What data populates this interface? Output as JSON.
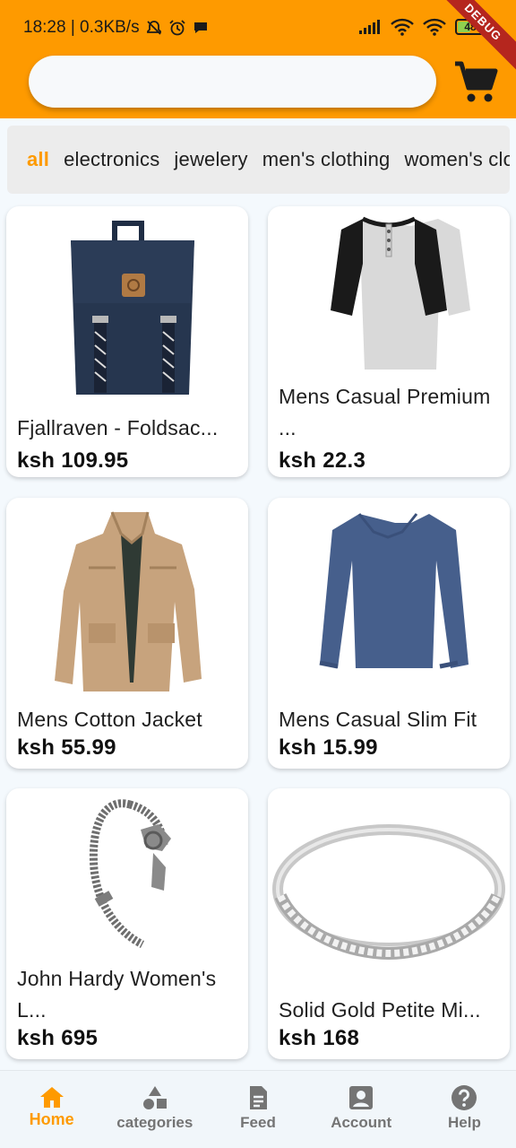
{
  "status_bar": {
    "time_speed": "18:28 | 0.3KB/s",
    "battery": "48"
  },
  "debug_banner": "DEBUG",
  "search": {
    "placeholder": ""
  },
  "categories": [
    "all",
    "electronics",
    "jewelery",
    "men's clothing",
    "women's clothing"
  ],
  "active_category": "all",
  "products": [
    {
      "name": "Fjallraven - Foldsac...",
      "price": "ksh 109.95",
      "image": "navy-backpack"
    },
    {
      "name": "Mens Casual Premium ...",
      "price": "ksh 22.3",
      "image": "raglan-tshirt"
    },
    {
      "name": "Mens Cotton Jacket",
      "price": "ksh 55.99",
      "image": "khaki-jacket"
    },
    {
      "name": "Mens Casual Slim Fit",
      "price": "ksh 15.99",
      "image": "blue-longsleeve"
    },
    {
      "name": "John Hardy Women's L...",
      "price": "ksh 695",
      "image": "silver-dragon-bracelet"
    },
    {
      "name": "Solid Gold Petite Mi...",
      "price": "ksh 168",
      "image": "diamond-ring"
    }
  ],
  "bottom_nav": [
    {
      "label": "Home",
      "icon": "home-icon",
      "active": true
    },
    {
      "label": "categories",
      "icon": "categories-icon",
      "active": false
    },
    {
      "label": "Feed",
      "icon": "feed-icon",
      "active": false
    },
    {
      "label": "Account",
      "icon": "account-icon",
      "active": false
    },
    {
      "label": "Help",
      "icon": "help-icon",
      "active": false
    }
  ],
  "colors": {
    "accent": "#fe9a00",
    "header": "#fe9a00",
    "background": "#f4f9fd"
  }
}
